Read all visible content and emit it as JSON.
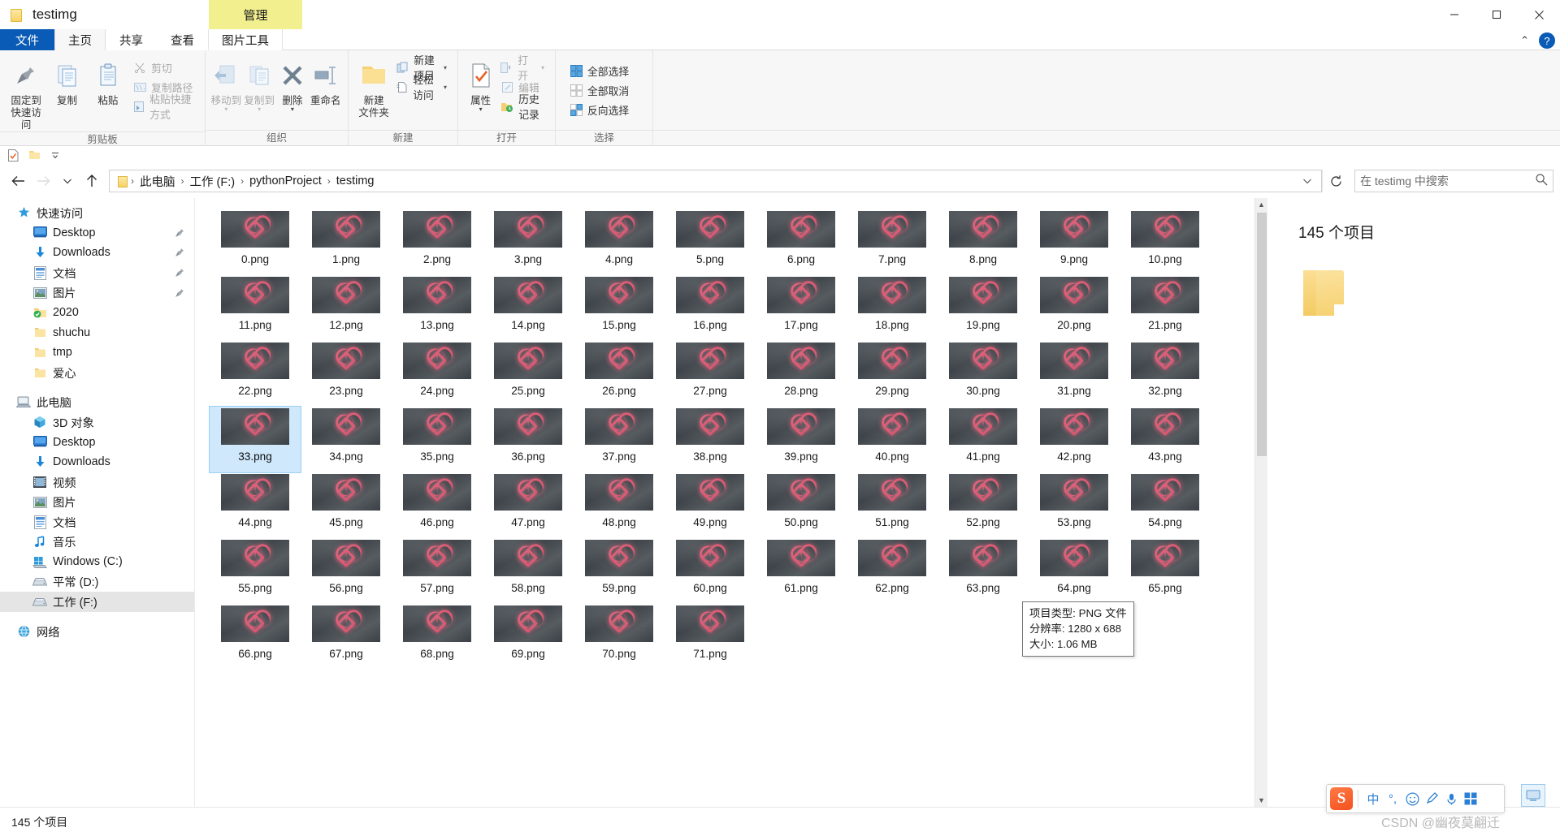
{
  "window": {
    "title": "testimg",
    "folder_icon": "folder-icon",
    "tool_tab_group": "管理",
    "minimize": "minimize-icon",
    "maximize": "maximize-icon",
    "close": "close-icon"
  },
  "tabs": [
    {
      "label": "文件",
      "key": "file"
    },
    {
      "label": "主页",
      "key": "home"
    },
    {
      "label": "共享",
      "key": "share"
    },
    {
      "label": "查看",
      "key": "view"
    },
    {
      "label": "图片工具",
      "key": "picture-tools"
    }
  ],
  "ribbon": {
    "collapse_chevron": "⌃",
    "help": "?",
    "groups": [
      {
        "label": "剪贴板",
        "big": [
          {
            "label": "固定到\n快速访问",
            "icon": "pin-icon",
            "disabled": false
          },
          {
            "label": "复制",
            "icon": "copy-icon",
            "disabled": false
          },
          {
            "label": "粘贴",
            "icon": "paste-icon",
            "disabled": false
          }
        ],
        "small": [
          {
            "label": "剪切",
            "icon": "scissors-icon",
            "disabled": true
          },
          {
            "label": "复制路径",
            "icon": "copy-path-icon",
            "disabled": true
          },
          {
            "label": "粘贴快捷方式",
            "icon": "paste-shortcut-icon",
            "disabled": true
          }
        ]
      },
      {
        "label": "组织",
        "big": [
          {
            "label": "移动到",
            "icon": "move-to-icon",
            "disabled": true,
            "caret": true
          },
          {
            "label": "复制到",
            "icon": "copy-to-icon",
            "disabled": true,
            "caret": true
          },
          {
            "label": "删除",
            "icon": "delete-x-icon",
            "disabled": false,
            "caret": true
          },
          {
            "label": "重命名",
            "icon": "rename-icon",
            "disabled": false
          }
        ],
        "small": []
      },
      {
        "label": "新建",
        "big": [
          {
            "label": "新建\n文件夹",
            "icon": "new-folder-icon",
            "disabled": false
          }
        ],
        "small": [
          {
            "label": "新建项目",
            "icon": "new-item-icon",
            "disabled": false,
            "caret": true
          },
          {
            "label": "轻松访问",
            "icon": "easy-access-icon",
            "disabled": false,
            "caret": true
          }
        ]
      },
      {
        "label": "打开",
        "big": [
          {
            "label": "属性",
            "icon": "properties-icon",
            "disabled": false,
            "caret": true
          }
        ],
        "small": [
          {
            "label": "打开",
            "icon": "open-icon",
            "disabled": true,
            "caret": true
          },
          {
            "label": "编辑",
            "icon": "edit-icon",
            "disabled": true
          },
          {
            "label": "历史记录",
            "icon": "history-icon",
            "disabled": false
          }
        ]
      },
      {
        "label": "选择",
        "big": [],
        "small": [
          {
            "label": "全部选择",
            "icon": "select-all-icon",
            "disabled": false
          },
          {
            "label": "全部取消",
            "icon": "select-none-icon",
            "disabled": false
          },
          {
            "label": "反向选择",
            "icon": "invert-selection-icon",
            "disabled": false
          }
        ]
      }
    ]
  },
  "quick_access_toolbar": {
    "items": [
      {
        "name": "properties-qat-icon"
      },
      {
        "name": "new-folder-qat-icon"
      },
      {
        "name": "customize-qat-chevron-icon"
      }
    ]
  },
  "address_bar": {
    "back": "back-arrow-icon",
    "forward": "forward-arrow-icon",
    "recent": "recent-locations-chevron-icon",
    "up": "up-arrow-icon",
    "breadcrumbs": [
      "此电脑",
      "工作 (F:)",
      "pythonProject",
      "testimg"
    ],
    "separator": "›",
    "dropdown": "address-dropdown-icon",
    "refresh": "refresh-icon",
    "search_placeholder": "在 testimg 中搜索",
    "search_icon": "search-icon"
  },
  "sidebar": {
    "items": [
      {
        "label": "快速访问",
        "icon": "quick-access-star-icon",
        "level": 0,
        "pin": false,
        "selected": false
      },
      {
        "label": "Desktop",
        "icon": "desktop-icon",
        "level": 1,
        "pin": true,
        "selected": false
      },
      {
        "label": "Downloads",
        "icon": "downloads-icon",
        "level": 1,
        "pin": true,
        "selected": false
      },
      {
        "label": "文档",
        "icon": "documents-icon",
        "level": 1,
        "pin": true,
        "selected": false
      },
      {
        "label": "图片",
        "icon": "pictures-icon",
        "level": 1,
        "pin": true,
        "selected": false
      },
      {
        "label": "2020",
        "icon": "onedrive-folder-icon",
        "level": 1,
        "pin": false,
        "selected": false
      },
      {
        "label": "shuchu",
        "icon": "folder-icon",
        "level": 1,
        "pin": false,
        "selected": false
      },
      {
        "label": "tmp",
        "icon": "folder-icon",
        "level": 1,
        "pin": false,
        "selected": false
      },
      {
        "label": "爱心",
        "icon": "folder-icon",
        "level": 1,
        "pin": false,
        "selected": false
      },
      {
        "label": "此电脑",
        "icon": "this-pc-icon",
        "level": 0,
        "pin": false,
        "selected": false,
        "spacer": true
      },
      {
        "label": "3D 对象",
        "icon": "3d-objects-icon",
        "level": 1,
        "pin": false,
        "selected": false
      },
      {
        "label": "Desktop",
        "icon": "desktop-icon",
        "level": 1,
        "pin": false,
        "selected": false
      },
      {
        "label": "Downloads",
        "icon": "downloads-icon",
        "level": 1,
        "pin": false,
        "selected": false
      },
      {
        "label": "视频",
        "icon": "videos-icon",
        "level": 1,
        "pin": false,
        "selected": false
      },
      {
        "label": "图片",
        "icon": "pictures-icon",
        "level": 1,
        "pin": false,
        "selected": false
      },
      {
        "label": "文档",
        "icon": "documents-icon",
        "level": 1,
        "pin": false,
        "selected": false
      },
      {
        "label": "音乐",
        "icon": "music-icon",
        "level": 1,
        "pin": false,
        "selected": false
      },
      {
        "label": "Windows (C:)",
        "icon": "windows-drive-icon",
        "level": 1,
        "pin": false,
        "selected": false
      },
      {
        "label": "平常 (D:)",
        "icon": "drive-icon",
        "level": 1,
        "pin": false,
        "selected": false
      },
      {
        "label": "工作 (F:)",
        "icon": "drive-icon",
        "level": 1,
        "pin": false,
        "selected": true
      },
      {
        "label": "网络",
        "icon": "network-icon",
        "level": 0,
        "pin": false,
        "selected": false,
        "spacer": true
      }
    ]
  },
  "files": {
    "selected": "33.png",
    "items": [
      "0.png",
      "1.png",
      "2.png",
      "3.png",
      "4.png",
      "5.png",
      "6.png",
      "7.png",
      "8.png",
      "9.png",
      "10.png",
      "11.png",
      "12.png",
      "13.png",
      "14.png",
      "15.png",
      "16.png",
      "17.png",
      "18.png",
      "19.png",
      "20.png",
      "21.png",
      "22.png",
      "23.png",
      "24.png",
      "25.png",
      "26.png",
      "27.png",
      "28.png",
      "29.png",
      "30.png",
      "31.png",
      "32.png",
      "33.png",
      "34.png",
      "35.png",
      "36.png",
      "37.png",
      "38.png",
      "39.png",
      "40.png",
      "41.png",
      "42.png",
      "43.png",
      "44.png",
      "45.png",
      "46.png",
      "47.png",
      "48.png",
      "49.png",
      "50.png",
      "51.png",
      "52.png",
      "53.png",
      "54.png",
      "55.png",
      "56.png",
      "57.png",
      "58.png",
      "59.png",
      "60.png",
      "61.png",
      "62.png",
      "63.png",
      "64.png",
      "65.png",
      "66.png",
      "67.png",
      "68.png",
      "69.png",
      "70.png",
      "71.png"
    ]
  },
  "tooltip": {
    "lines": [
      "项目类型: PNG 文件",
      "分辨率: 1280 x 688",
      "大小: 1.06 MB"
    ]
  },
  "detail_pane": {
    "count_text": "145 个项目",
    "folder_icon": "large-folder-icon"
  },
  "status_bar": {
    "text": "145 个项目"
  },
  "ime": {
    "brand": "S",
    "mode": "中",
    "punct": "°,",
    "emoji": "emoji-icon",
    "pen": "pen-icon",
    "mic": "mic-icon",
    "apps": "toolbox-icon"
  },
  "watermark": {
    "text": "CSDN @幽夜莫翩迁"
  },
  "colors": {
    "accent": "#0a5bb5",
    "tool_tab": "#f2ef8f",
    "selection": "#cfe8fb",
    "ribbon_bg": "#f7f7f7"
  }
}
